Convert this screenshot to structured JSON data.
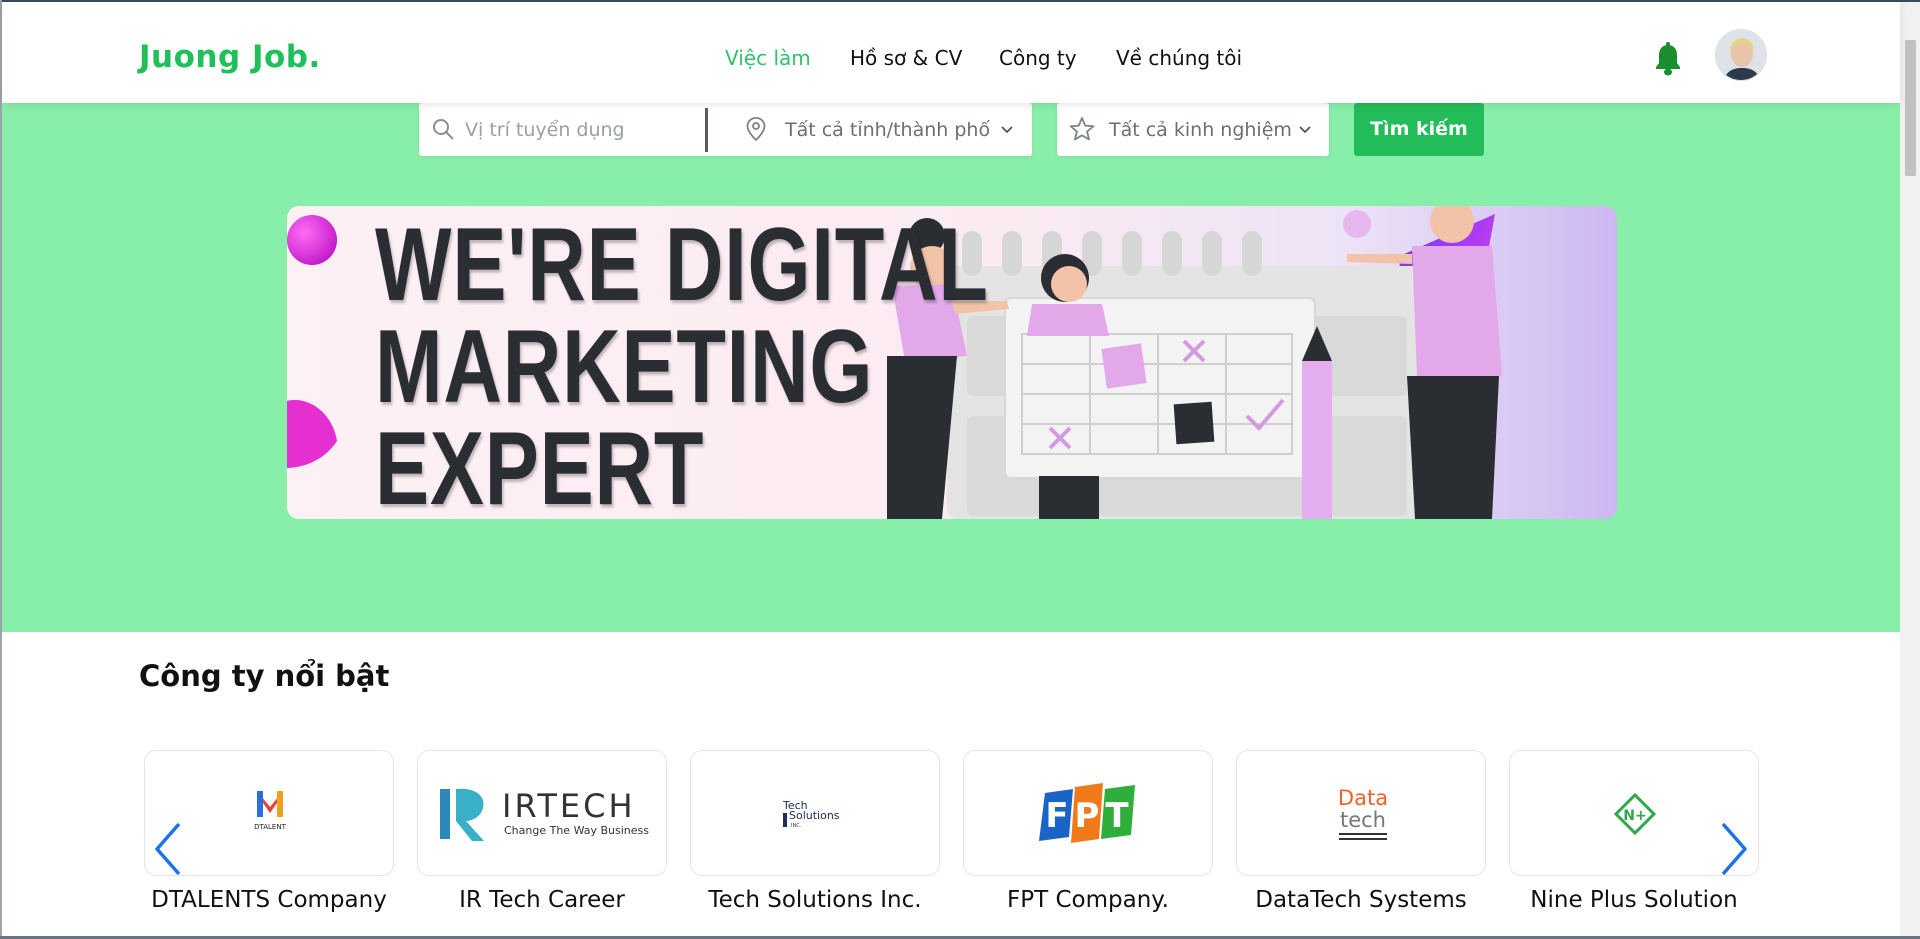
{
  "header": {
    "logo": "Juong Job.",
    "nav": [
      "Việc làm",
      "Hồ sơ & CV",
      "Công ty",
      "Về chúng tôi"
    ],
    "active_nav": "Việc làm",
    "icons": [
      "bell-icon",
      "user-avatar"
    ]
  },
  "search": {
    "keyword_placeholder": "Vị trí tuyển dụng",
    "location": "Tất cả tỉnh/thành phố",
    "experience": "Tất cả kinh nghiệm",
    "button_label": "Tìm kiếm"
  },
  "banner": {
    "title_lines": [
      "WE'RE DIGITAL",
      "MARKETING",
      "EXPERT"
    ]
  },
  "companies": {
    "title": "Công ty nổi bật",
    "items": [
      {
        "name": "DTALENTS Company",
        "logo_text": "DTALENT"
      },
      {
        "name": "IR Tech Career",
        "logo_text": "IRTECH",
        "logo_tagline": "Change The Way Business"
      },
      {
        "name": "Tech Solutions Inc.",
        "logo_text": "Tech Solutions"
      },
      {
        "name": "FPT Company.",
        "logo_text": "FPT"
      },
      {
        "name": "DataTech Systems",
        "logo_text": "Data tech"
      },
      {
        "name": "Nine Plus Solution",
        "logo_text": "N+"
      }
    ]
  },
  "colors": {
    "brand": "#1fbf5a",
    "hero_bg": "#88efab",
    "button": "#22bd58",
    "arrow": "#1a73e8"
  }
}
